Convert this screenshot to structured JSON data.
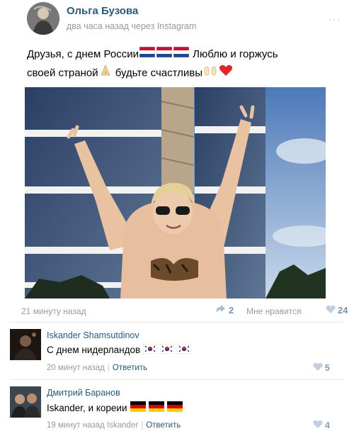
{
  "post": {
    "author": "Ольга Бузова",
    "meta": "два часа назад через Instagram",
    "menu_glyph": "···",
    "text_line1": "Друзья, с днем России",
    "text_line1_tail": "Люблю и горжусь",
    "text_line2": "своей страной",
    "text_line2_tail": "будьте счастливы",
    "emojis_line1": [
      "flag-nl",
      "flag-nl",
      "flag-nl"
    ],
    "emojis_line2": [
      "folded-hands",
      "raised-hands",
      "red-heart"
    ],
    "photo": {
      "description_icon": "woman-in-bikini-photo"
    }
  },
  "footer": {
    "time": "21 минуту назад",
    "share_count": "2",
    "like_label": "Мне нравится",
    "like_count": "24"
  },
  "comments": [
    {
      "author": "Iskander Shamsutdinov",
      "text": "С днем нидерландов",
      "emojis": [
        "flag-kr",
        "flag-kr",
        "flag-kr"
      ],
      "time": "20 минут назад",
      "reply_label": "Ответить",
      "likes": "5"
    },
    {
      "author": "Дмитрий Баранов",
      "text": "Iskander, и кореии",
      "emojis": [
        "flag-de",
        "flag-de",
        "flag-de"
      ],
      "time": "19 минут назад Iskander",
      "reply_label": "Ответить",
      "likes": "4"
    }
  ],
  "colors": {
    "link": "#2b587a",
    "muted": "#9a9a9a",
    "like_accent": "#7a94b0"
  }
}
